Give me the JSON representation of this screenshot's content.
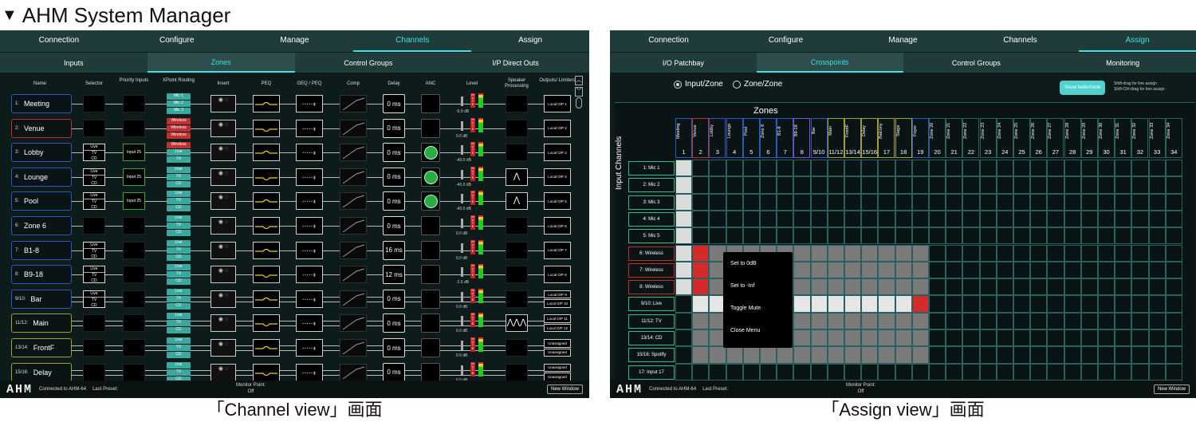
{
  "heading": {
    "glyph": "▼",
    "text": "AHM System Manager"
  },
  "captions": {
    "left": "「Channel view」画面",
    "right": "「Assign view」画面"
  },
  "channel_view": {
    "tabs": [
      "Connection",
      "Configure",
      "Manage",
      "Channels",
      "Assign"
    ],
    "active_tab": "Channels",
    "subtabs": [
      "Inputs",
      "Zones",
      "Control Groups",
      "I/P Direct Outs"
    ],
    "active_subtab": "Zones",
    "columns": [
      "Name",
      "Selector",
      "Priority Inputs",
      "XPoint Routing",
      "Insert",
      "PEQ",
      "GEQ / PEQ",
      "Comp",
      "Delay",
      "ANC",
      "Level",
      "Speaker Processing",
      "Outputs/ Limiters"
    ],
    "rows": [
      {
        "num": "1:",
        "name": "Meeting",
        "xp": [
          "Mic 1",
          "Mic 2",
          "Mic 3"
        ],
        "xp_color": "#3aa89e",
        "delay": "0 ms",
        "level": "-5.9 dB",
        "outs": [
          "Local O/P 1"
        ],
        "anc": false,
        "selector": false,
        "priority": "",
        "border": "#2a5ac0"
      },
      {
        "num": "2:",
        "name": "Venue",
        "xp": [
          "Wireless",
          "Wireless",
          "Wireless"
        ],
        "xp_color": "#c03030",
        "delay": "0 ms",
        "level": "0.0 dB",
        "outs": [
          "Local O/P 2"
        ],
        "anc": false,
        "selector": false,
        "priority": "",
        "border": "#c03030"
      },
      {
        "num": "3:",
        "name": "Lobby",
        "xp": [
          "Wireless",
          "Live",
          "TV"
        ],
        "xp_color": "#3aa89e",
        "delay": "0 ms",
        "level": "-40.0 dB",
        "outs": [
          "Local O/P 3"
        ],
        "anc": true,
        "selector": true,
        "priority": "Input 25",
        "border": "#2a5ac0"
      },
      {
        "num": "4:",
        "name": "Lounge",
        "xp": [
          "Live",
          "TV",
          "CD"
        ],
        "xp_color": "#3aa89e",
        "delay": "0 ms",
        "level": "-40.0 dB",
        "outs": [
          "Local O/P 4"
        ],
        "anc": true,
        "selector": true,
        "priority": "Input 25",
        "border": "#2a5ac0"
      },
      {
        "num": "5:",
        "name": "Pool",
        "xp": [
          "Live",
          "TV",
          "CD"
        ],
        "xp_color": "#3aa89e",
        "delay": "0 ms",
        "level": "-40.0 dB",
        "outs": [
          "Local O/P 5"
        ],
        "anc": true,
        "selector": true,
        "priority": "Input 25",
        "border": "#2a5ac0"
      },
      {
        "num": "6:",
        "name": "Zone 6",
        "xp": [
          "Live",
          "TV",
          "CD"
        ],
        "xp_color": "#3aa89e",
        "delay": "0 ms",
        "level": "0.0 dB",
        "outs": [
          "Local O/P 6"
        ],
        "anc": false,
        "selector": false,
        "priority": "",
        "border": "#2a5ac0"
      },
      {
        "num": "7:",
        "name": "B1-8",
        "xp": [
          "Live",
          "TV",
          "CD"
        ],
        "xp_color": "#3aa89e",
        "delay": "16 ms",
        "level": "0.0 dB",
        "outs": [
          "Local O/P 7"
        ],
        "anc": false,
        "selector": true,
        "priority": "",
        "border": "#2a5ac0"
      },
      {
        "num": "8:",
        "name": "B9-18",
        "xp": [
          "Live",
          "TV",
          "CD"
        ],
        "xp_color": "#3aa89e",
        "delay": "12 ms",
        "level": "-2.6 dB",
        "outs": [
          "Local O/P 8"
        ],
        "anc": false,
        "selector": true,
        "priority": "",
        "border": "#2a5ac0"
      },
      {
        "num": "9/10:",
        "name": "Bar",
        "xp": [
          "Live",
          "TV",
          "CD"
        ],
        "xp_color": "#3aa89e",
        "delay": "0 ms",
        "level": "0.0 dB",
        "outs": [
          "Local O/P 9",
          "Local O/P 10"
        ],
        "anc": false,
        "selector": true,
        "priority": "",
        "border": "#2a5ac0"
      },
      {
        "num": "11/12:",
        "name": "Main",
        "xp": [
          "Live",
          "TV",
          "CD"
        ],
        "xp_color": "#3aa89e",
        "delay": "0 ms",
        "level": "0.0 dB",
        "outs": [
          "Local O/P 11",
          "Local O/P 12"
        ],
        "anc": false,
        "selector": false,
        "priority": "",
        "border": "#a0a030"
      },
      {
        "num": "13/14:",
        "name": "FrontF",
        "xp": [
          "Live",
          "TV",
          "CD"
        ],
        "xp_color": "#3aa89e",
        "delay": "0 ms",
        "level": "0.0 dB",
        "outs": [
          "Unassigned",
          "Unassigned"
        ],
        "anc": false,
        "selector": false,
        "priority": "",
        "border": "#a0a030"
      },
      {
        "num": "15/16:",
        "name": "Delay",
        "xp": [
          "Live",
          "TV",
          "CD"
        ],
        "xp_color": "#3aa89e",
        "delay": "0 ms",
        "level": "0.0 dB",
        "outs": [
          "Unassigned",
          "Unassigned"
        ],
        "anc": false,
        "selector": false,
        "priority": "",
        "border": "#a0a030"
      }
    ],
    "mute_label": "MUTE",
    "footer": {
      "logo": "AHM",
      "status": "Connected to AHM-64",
      "last_preset": "Last Preset:",
      "monitor_point": "Monitor Point:",
      "monitor_value": "Off",
      "new_window": "New Window"
    }
  },
  "assign_view": {
    "tabs": [
      "Connection",
      "Configure",
      "Manage",
      "Channels",
      "Assign"
    ],
    "active_tab": "Assign",
    "subtabs": [
      "I/O Patchbay",
      "Crosspoints",
      "Control Groups",
      "Monitoring"
    ],
    "active_subtab": "Crosspoints",
    "radio": [
      {
        "label": "Input/Zone",
        "on": true
      },
      {
        "label": "Zone/Zone",
        "on": false
      }
    ],
    "show_fader_button": "Show fader/mute",
    "hint_lines": [
      "Shift-drag for line assign",
      "Shift-Ctrl-drag for box assign"
    ],
    "zones_title": "Zones",
    "input_channels_label": "Input Channels",
    "zones": [
      {
        "label": "Meeting",
        "num": "1",
        "color": "#2a5ac0"
      },
      {
        "label": "Venue",
        "num": "2",
        "color": "#c03030"
      },
      {
        "label": "Lobby",
        "num": "3",
        "color": "#2a5ac0"
      },
      {
        "label": "Lounge",
        "num": "4",
        "color": "#2a5ac0"
      },
      {
        "label": "Pool",
        "num": "5",
        "color": "#2a5ac0"
      },
      {
        "label": "Zone 6",
        "num": "6",
        "color": "#2a5ac0"
      },
      {
        "label": "B1-8",
        "num": "7",
        "color": "#2a5ac0"
      },
      {
        "label": "B9-18",
        "num": "8",
        "color": "#8a50c0"
      },
      {
        "label": "Bar",
        "num": "9/10",
        "color": "#2a5ac0"
      },
      {
        "label": "Main",
        "num": "11/12",
        "color": "#a0a030"
      },
      {
        "label": "FrontF",
        "num": "13/14",
        "color": "#a0a030"
      },
      {
        "label": "Delay",
        "num": "15/16",
        "color": "#a0a030"
      },
      {
        "label": "Balcony",
        "num": "17",
        "color": "#a0a030"
      },
      {
        "label": "Stage",
        "num": "18",
        "color": "#a0a030"
      },
      {
        "label": "Foyer",
        "num": "19",
        "color": "#2a5ac0"
      },
      {
        "label": "Zone 20",
        "num": "20",
        "color": "#2b6060"
      },
      {
        "label": "Zone 21",
        "num": "21",
        "color": "#2b6060"
      },
      {
        "label": "Zone 22",
        "num": "22",
        "color": "#2b6060"
      },
      {
        "label": "Zone 23",
        "num": "23",
        "color": "#2b6060"
      },
      {
        "label": "Zone 24",
        "num": "24",
        "color": "#2b6060"
      },
      {
        "label": "Zone 25",
        "num": "25",
        "color": "#2b6060"
      },
      {
        "label": "Zone 26",
        "num": "26",
        "color": "#2b6060"
      },
      {
        "label": "Zone 27",
        "num": "27",
        "color": "#2b6060"
      },
      {
        "label": "Zone 28",
        "num": "28",
        "color": "#2b6060"
      },
      {
        "label": "Zone 29",
        "num": "29",
        "color": "#2b6060"
      },
      {
        "label": "Zone 30",
        "num": "30",
        "color": "#2b6060"
      },
      {
        "label": "Zone 31",
        "num": "31",
        "color": "#2b6060"
      },
      {
        "label": "Zone 32",
        "num": "32",
        "color": "#2b6060"
      },
      {
        "label": "Zone 33",
        "num": "33",
        "color": "#2b6060"
      },
      {
        "label": "Zone 34",
        "num": "34",
        "color": "#2b6060"
      }
    ],
    "inputs": [
      "1: Mic 1",
      "2: Mic 2",
      "3: Mic 3",
      "4: Mic 4",
      "5: Mic 5",
      "6: Wireless",
      "7: Wireless",
      "8: Wireless",
      "9/10: Live",
      "11/12: TV",
      "13/14: CD",
      "15/16: Spotify",
      "17: Input 17"
    ],
    "context_menu": [
      "Set to 0dB",
      "Set to -Inf",
      "Toggle Mute",
      "Close Menu"
    ],
    "footer": {
      "logo": "AHM",
      "status": "Connected to AHM-64",
      "last_preset": "Last Preset:",
      "monitor_point": "Monitor Point:",
      "monitor_value": "Off",
      "new_window": "New Window"
    }
  }
}
